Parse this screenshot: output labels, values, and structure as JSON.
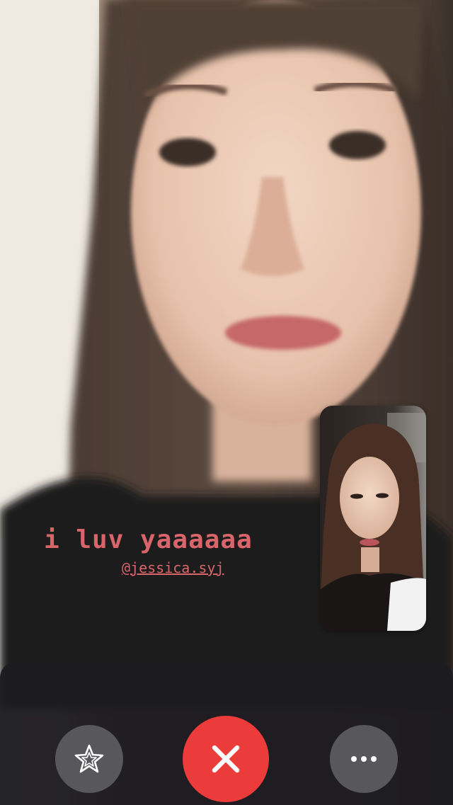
{
  "call": {
    "remote_participant_description": "blurred video of woman with long dark hair smiling"
  },
  "sticker": {
    "text": "i luv yaaaaaa",
    "mention": "@jessica.syj"
  },
  "controls": {
    "effects_icon": "star-effects-icon",
    "end_icon": "close-x-icon",
    "more_icon": "ellipsis-icon",
    "end_color": "#eb3b3a",
    "secondary_color": "#58575c"
  },
  "colors": {
    "sticker_text": "#d9656b"
  }
}
